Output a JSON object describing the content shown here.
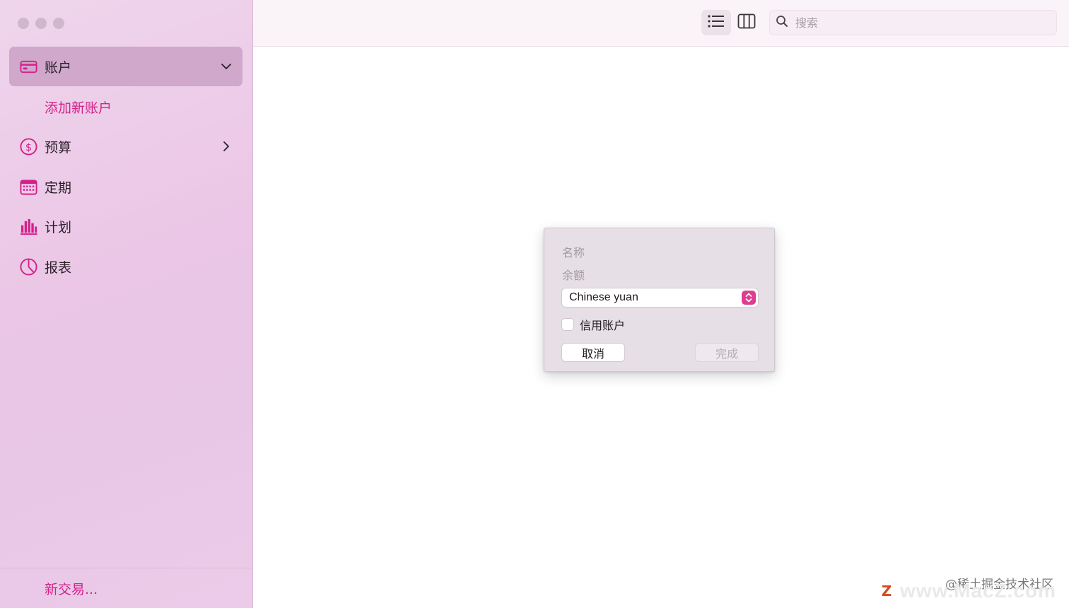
{
  "sidebar": {
    "items": [
      {
        "label": "账户",
        "icon": "credit-card-icon",
        "selected": true
      },
      {
        "label": "预算",
        "icon": "dollar-circle-icon"
      },
      {
        "label": "定期",
        "icon": "calendar-icon"
      },
      {
        "label": "计划",
        "icon": "bar-chart-icon"
      },
      {
        "label": "报表",
        "icon": "pie-chart-icon"
      }
    ],
    "add_account": "添加新账户",
    "new_transaction": "新交易..."
  },
  "toolbar": {
    "search_placeholder": "搜索",
    "list_view": "list-view-icon",
    "column_view": "column-view-icon"
  },
  "dialog": {
    "name_label": "名称",
    "balance_label": "余额",
    "currency": "Chinese yuan",
    "credit_account_label": "信用账户",
    "credit_account_checked": false,
    "cancel": "取消",
    "done": "完成"
  },
  "watermark": {
    "site": "www.MacZ.com",
    "community": "@稀土掘金技术社区"
  },
  "colors": {
    "accent": "#d4218a",
    "sidebar_bg": "#ebc6e6",
    "selected_bg": "#cfa8cb"
  }
}
